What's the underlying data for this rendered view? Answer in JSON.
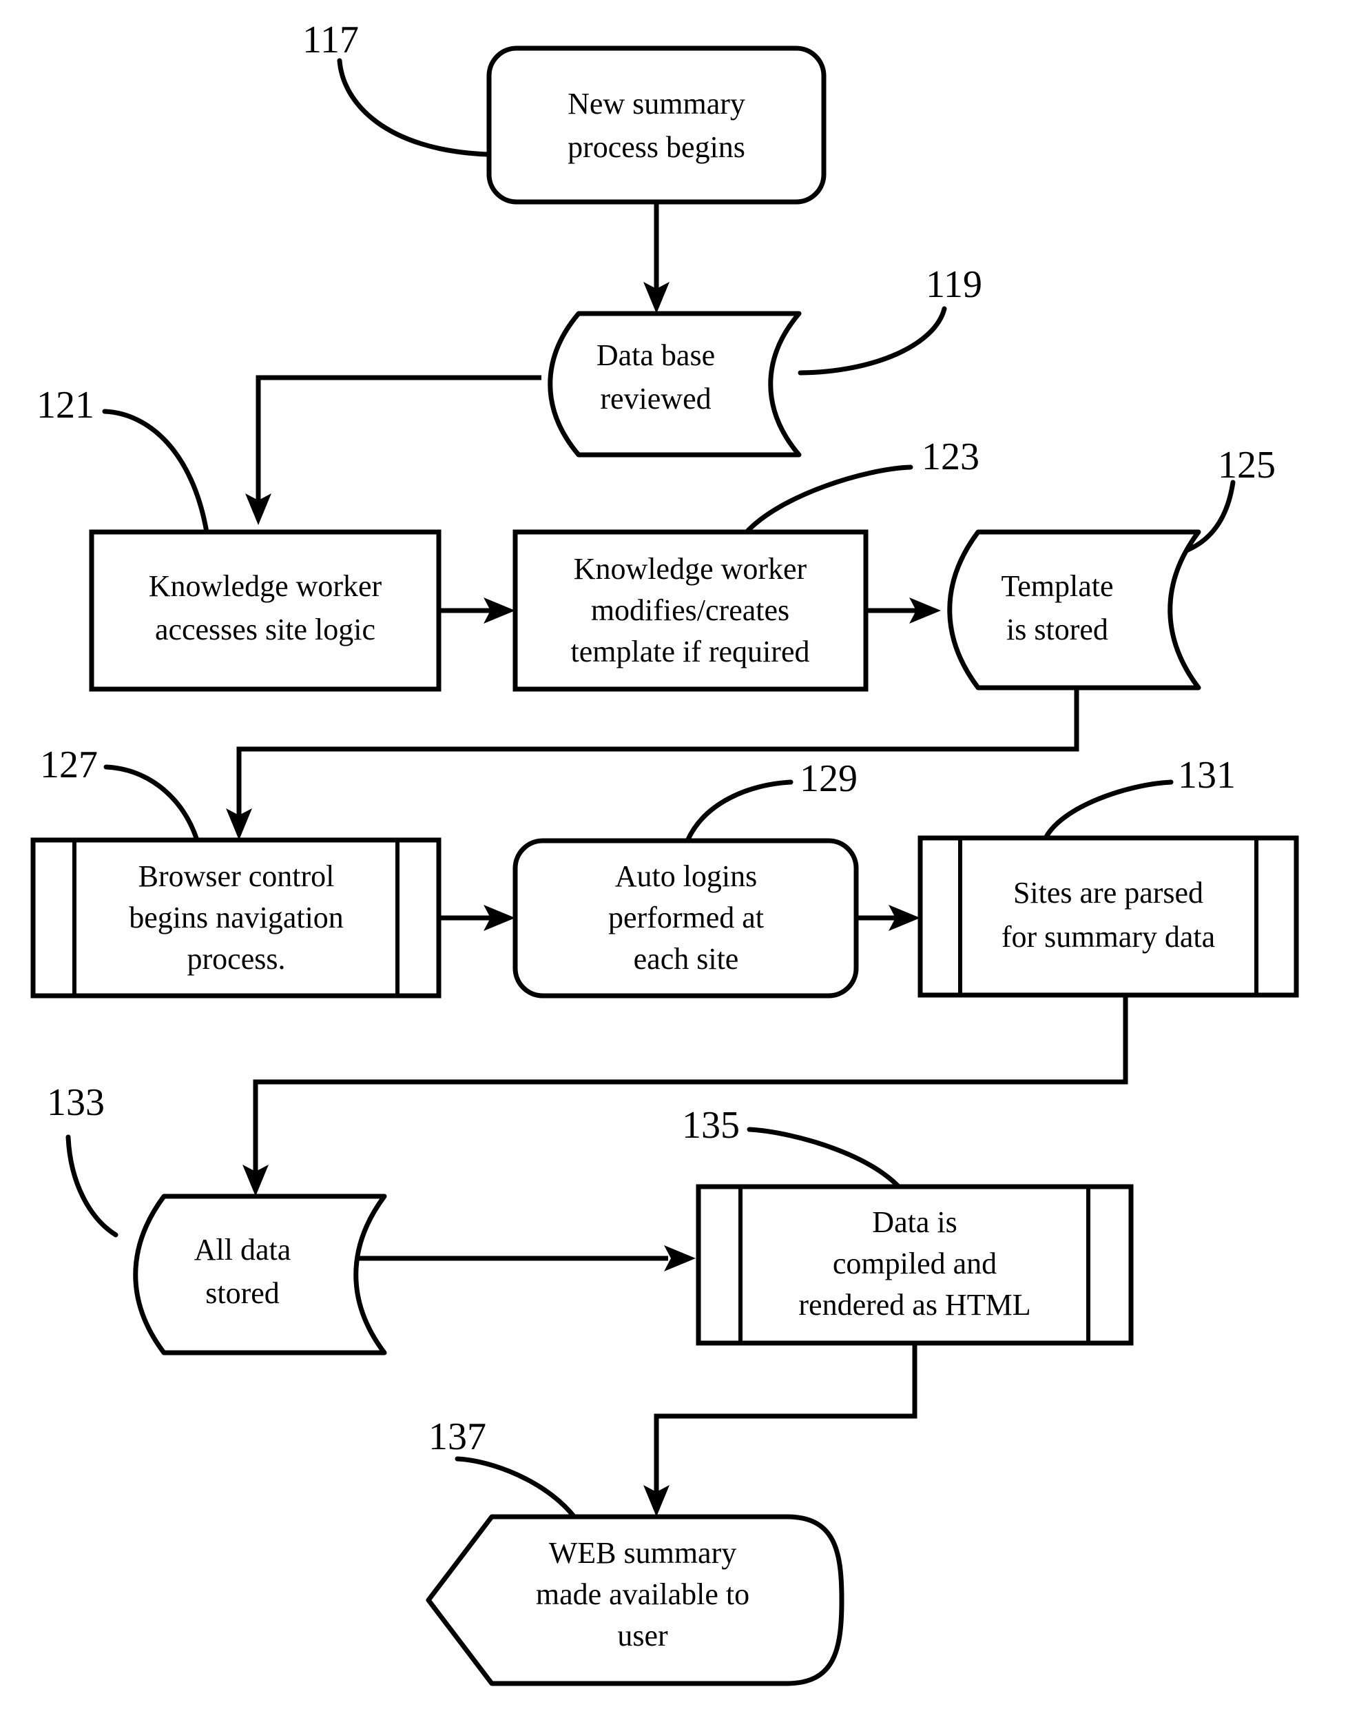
{
  "figure": {
    "kind": "patent-flowchart",
    "background_color": "#ffffff",
    "line_color": "#000000"
  },
  "nodes": [
    {
      "ref": "117",
      "shape": "rounded-rectangle",
      "lines": [
        "New summary",
        "process begins"
      ]
    },
    {
      "ref": "119",
      "shape": "stored-data",
      "lines": [
        "Data base",
        "reviewed"
      ]
    },
    {
      "ref": "121",
      "shape": "rectangle",
      "lines": [
        "Knowledge worker",
        "accesses site logic"
      ]
    },
    {
      "ref": "123",
      "shape": "rectangle",
      "lines": [
        "Knowledge worker",
        "modifies/creates",
        "template if required"
      ]
    },
    {
      "ref": "125",
      "shape": "stored-data",
      "lines": [
        "Template",
        "is stored"
      ]
    },
    {
      "ref": "127",
      "shape": "predefined-process",
      "lines": [
        "Browser control",
        "begins navigation",
        "process."
      ]
    },
    {
      "ref": "129",
      "shape": "rounded-rectangle",
      "lines": [
        "Auto logins",
        "performed at",
        "each site"
      ]
    },
    {
      "ref": "131",
      "shape": "predefined-process",
      "lines": [
        "Sites are parsed",
        "for summary data"
      ]
    },
    {
      "ref": "133",
      "shape": "stored-data",
      "lines": [
        "All data",
        "stored"
      ]
    },
    {
      "ref": "135",
      "shape": "predefined-process",
      "lines": [
        "Data is",
        "compiled and",
        "rendered as HTML"
      ]
    },
    {
      "ref": "137",
      "shape": "display",
      "lines": [
        "WEB summary",
        "made available to",
        "user"
      ]
    }
  ],
  "node_text": {
    "n117_l1": "New summary",
    "n117_l2": "process begins",
    "n119_l1": "Data base",
    "n119_l2": "reviewed",
    "n121_l1": "Knowledge worker",
    "n121_l2": "accesses site logic",
    "n123_l1": "Knowledge worker",
    "n123_l2": "modifies/creates",
    "n123_l3": "template if required",
    "n125_l1": "Template",
    "n125_l2": "is stored",
    "n127_l1": "Browser control",
    "n127_l2": "begins navigation",
    "n127_l3": "process.",
    "n129_l1": "Auto logins",
    "n129_l2": "performed at",
    "n129_l3": "each site",
    "n131_l1": "Sites are parsed",
    "n131_l2": "for summary data",
    "n133_l1": "All data",
    "n133_l2": "stored",
    "n135_l1": "Data is",
    "n135_l2": "compiled and",
    "n135_l3": "rendered as HTML",
    "n137_l1": "WEB summary",
    "n137_l2": "made available to",
    "n137_l3": "user"
  },
  "ref_labels": {
    "r117": "117",
    "r119": "119",
    "r121": "121",
    "r123": "123",
    "r125": "125",
    "r127": "127",
    "r129": "129",
    "r131": "131",
    "r133": "133",
    "r135": "135",
    "r137": "137"
  },
  "edges": [
    {
      "from": "117",
      "to": "119",
      "style": "straight-down-arrow"
    },
    {
      "from": "119",
      "to": "121",
      "style": "left-then-down-arrow"
    },
    {
      "from": "121",
      "to": "123",
      "style": "right-arrow"
    },
    {
      "from": "123",
      "to": "125",
      "style": "right-arrow"
    },
    {
      "from": "125",
      "to": "127",
      "style": "down-left-down-arrow"
    },
    {
      "from": "127",
      "to": "129",
      "style": "right-arrow"
    },
    {
      "from": "129",
      "to": "131",
      "style": "right-arrow"
    },
    {
      "from": "131",
      "to": "133",
      "style": "down-left-down-arrow"
    },
    {
      "from": "133",
      "to": "135",
      "style": "right-arrow"
    },
    {
      "from": "135",
      "to": "137",
      "style": "down-left-down-arrow"
    }
  ]
}
